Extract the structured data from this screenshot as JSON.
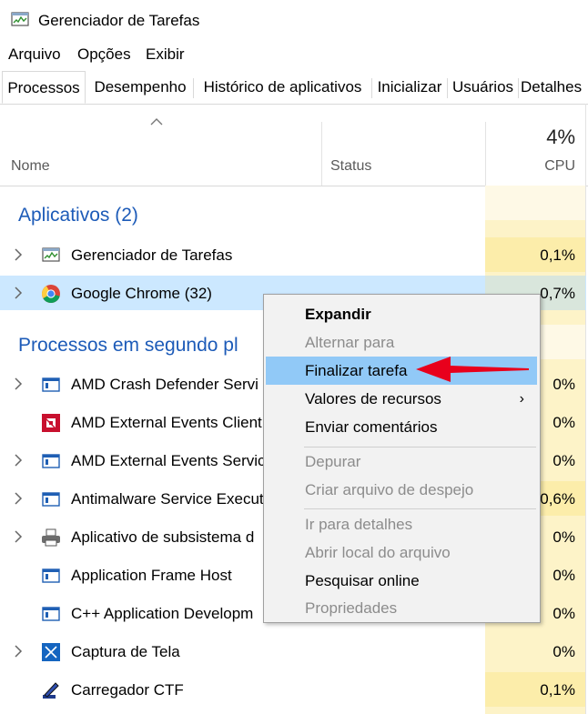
{
  "window": {
    "title": "Gerenciador de Tarefas"
  },
  "menubar": [
    "Arquivo",
    "Opções",
    "Exibir"
  ],
  "tabs": [
    "Processos",
    "Desempenho",
    "Histórico de aplicativos",
    "Inicializar",
    "Usuários",
    "Detalhes"
  ],
  "header": {
    "name": "Nome",
    "status": "Status",
    "cpu_pct": "4%",
    "cpu": "CPU"
  },
  "groups": {
    "apps": "Aplicativos (2)",
    "background": "Processos em segundo pl"
  },
  "rows": [
    {
      "name": "Gerenciador de Tarefas",
      "cpu": "0,1%",
      "icon": "task-manager-icon",
      "expand": true
    },
    {
      "name": "Google Chrome (32)",
      "cpu": "0,7%",
      "icon": "chrome-icon",
      "expand": true,
      "selected": true
    },
    {
      "name": "AMD Crash Defender Servi",
      "cpu": "0%",
      "icon": "service-window-icon",
      "expand": true
    },
    {
      "name": "AMD External Events Client",
      "cpu": "0%",
      "icon": "amd-logo-icon",
      "expand": false
    },
    {
      "name": "AMD External Events Servic",
      "cpu": "0%",
      "icon": "service-window-icon",
      "expand": true
    },
    {
      "name": "Antimalware Service Execut",
      "cpu": "0,6%",
      "icon": "service-window-icon",
      "expand": true
    },
    {
      "name": "Aplicativo de subsistema d",
      "cpu": "0%",
      "icon": "printer-icon",
      "expand": true
    },
    {
      "name": "Application Frame Host",
      "cpu": "0%",
      "icon": "service-window-icon",
      "expand": false
    },
    {
      "name": "C++ Application Developm",
      "cpu": "0%",
      "icon": "service-window-icon",
      "expand": false
    },
    {
      "name": "Captura de Tela",
      "cpu": "0%",
      "icon": "snipping-tool-icon",
      "expand": true
    },
    {
      "name": "Carregador CTF",
      "cpu": "0,1%",
      "icon": "ctf-pen-icon",
      "expand": false
    }
  ],
  "context_menu": {
    "items": [
      {
        "label": "Expandir",
        "style": "bold"
      },
      {
        "label": "Alternar para",
        "style": "disabled"
      },
      {
        "label": "Finalizar tarefa",
        "style": "highlighted"
      },
      {
        "label": "Valores de recursos",
        "style": "submenu"
      },
      {
        "label": "Enviar comentários",
        "style": "normal"
      },
      {
        "label": "Depurar",
        "style": "disabled"
      },
      {
        "label": "Criar arquivo de despejo",
        "style": "disabled"
      },
      {
        "label": "Ir para detalhes",
        "style": "disabled"
      },
      {
        "label": "Abrir local do arquivo",
        "style": "disabled"
      },
      {
        "label": "Pesquisar online",
        "style": "normal"
      },
      {
        "label": "Propriedades",
        "style": "disabled"
      }
    ]
  },
  "colors": {
    "group_blue": "#1d5bb8",
    "cpu_yellow": "#fdf3c8",
    "selection": "#cce8ff",
    "menu_highlight": "#91c9f7",
    "annotation_red": "#e8001c"
  }
}
